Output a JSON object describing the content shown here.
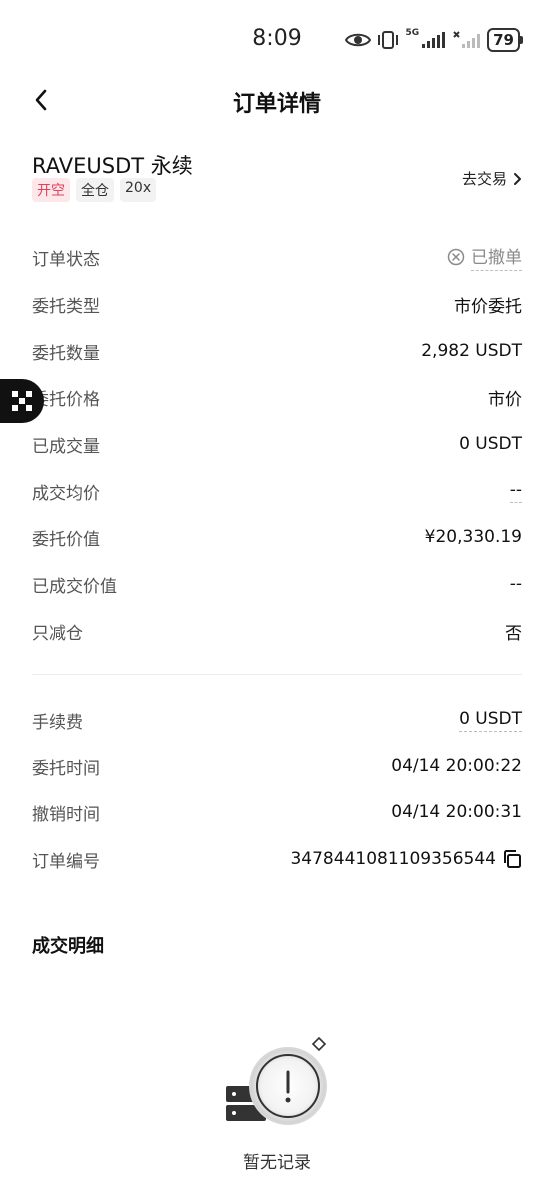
{
  "status": {
    "time": "8:09",
    "signal_label": "5G",
    "battery": "79"
  },
  "nav": {
    "title": "订单详情"
  },
  "pair": {
    "name": "RAVEUSDT 永续",
    "tags": [
      "开空",
      "全仓",
      "20x"
    ],
    "goto_trade": "去交易"
  },
  "details": [
    {
      "label": "订单状态",
      "value": "已撤单"
    },
    {
      "label": "委托类型",
      "value": "市价委托"
    },
    {
      "label": "委托数量",
      "value": "2,982 USDT"
    },
    {
      "label": "委托价格",
      "value": "市价"
    },
    {
      "label": "已成交量",
      "value": "0 USDT"
    },
    {
      "label": "成交均价",
      "value": "--"
    },
    {
      "label": "委托价值",
      "value": "¥20,330.19"
    },
    {
      "label": "已成交价值",
      "value": "--"
    },
    {
      "label": "只减仓",
      "value": "否"
    }
  ],
  "fees": [
    {
      "label": "手续费",
      "value": "0 USDT"
    },
    {
      "label": "委托时间",
      "value": "04/14 20:00:22"
    },
    {
      "label": "撤销时间",
      "value": "04/14 20:00:31"
    },
    {
      "label": "订单编号",
      "value": "3478441081109356544"
    }
  ],
  "trades": {
    "title": "成交明细",
    "empty": "暂无记录"
  }
}
